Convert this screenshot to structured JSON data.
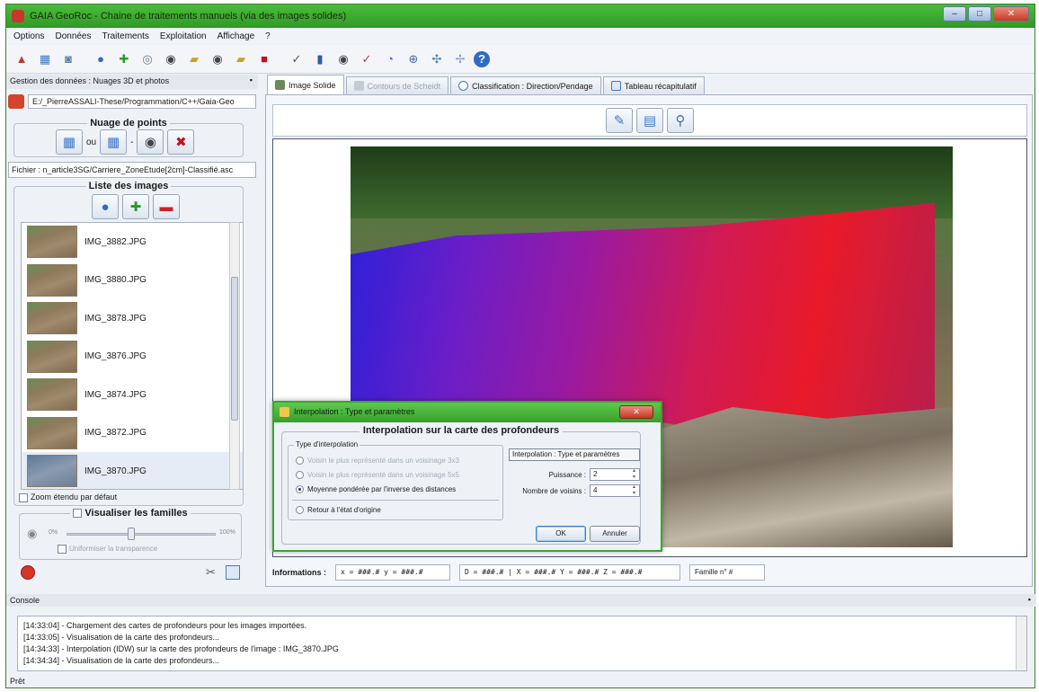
{
  "window": {
    "title": "GAIA GeoRoc - Chaine de traitements manuels (via des images solides)",
    "controls": {
      "minimize": "–",
      "maximize": "□",
      "close": "✕"
    }
  },
  "menu": [
    "Options",
    "Données",
    "Traitements",
    "Exploitation",
    "Affichage",
    "?"
  ],
  "toolbar_icons": [
    "open-project-icon",
    "gallery-icon",
    "camera-icon",
    "add-user-icon",
    "add-icon",
    "target-icon",
    "eye-icon",
    "folder-icon",
    "eye2-icon",
    "folder2-icon",
    "stop-icon",
    "check-icon",
    "book-icon",
    "eye3-icon",
    "check2-icon",
    "compass-icon",
    "zoom-icon",
    "pin-icon",
    "pin2-icon",
    "help-icon"
  ],
  "left_dock": {
    "title": "Gestion des données : Nuages 3D et photos",
    "path": "E:/_PierreASSALI-These/Programmation/C++/Gaia-Geo",
    "cloud_group_title": "Nuage de points",
    "ou_label": "ou",
    "file_label": "Fichier : n_article3SG/Carriere_ZoneEtude[2cm]-Classifié.asc",
    "images_group_title": "Liste des images",
    "images": [
      "IMG_3882.JPG",
      "IMG_3880.JPG",
      "IMG_3878.JPG",
      "IMG_3876.JPG",
      "IMG_3874.JPG",
      "IMG_3872.JPG",
      "IMG_3870.JPG"
    ],
    "selected_image_index": 6,
    "zoom_checkbox": "Zoom étendu par défaut",
    "families_title": "Visualiser les familles",
    "slider_min": "0%",
    "slider_max": "100%",
    "uniform_checkbox": "Uniformiser la transparence"
  },
  "tabs": [
    {
      "label": "Image Solide",
      "active": true
    },
    {
      "label": "Contours de Scheidt",
      "active": false
    },
    {
      "label": "Classification : Direction/Pendage",
      "active": false
    },
    {
      "label": "Tableau récapitulatif",
      "active": false
    }
  ],
  "info_bar": {
    "label": "Informations :",
    "xy": "x = ###.# y = ###.#",
    "coords": "D = ###.# | X = ###.# Y = ###.# Z = ###.#",
    "family": "Famille n° #"
  },
  "dialog": {
    "title": "Interpolation : Type et paramètres",
    "group_title": "Interpolation sur la carte des profondeurs",
    "type_title": "Type d'interpolation",
    "options": [
      {
        "label": "Voisin le plus représenté dans un voisinage 3x3",
        "enabled": false,
        "checked": false
      },
      {
        "label": "Voisin le plus représenté dans un voisinage 5x5",
        "enabled": false,
        "checked": false
      },
      {
        "label": "Moyenne pondérée par l'inverse des distances",
        "enabled": true,
        "checked": true
      }
    ],
    "reset_label": "Retour à l'état d'origine",
    "param_tag": "Interpolation : Type et paramètres",
    "power_label": "Puissance :",
    "power_value": "2",
    "neighbors_label": "Nombre de voisins :",
    "neighbors_value": "4",
    "ok_label": "OK",
    "cancel_label": "Annuler"
  },
  "console": {
    "title": "Console",
    "lines": [
      "[14:33:04] - Chargement des cartes de profondeurs pour les images importées.",
      "[14:33:05] - Visualisation de la carte des profondeurs...",
      "[14:34:33] - Interpolation (IDW) sur la carte des profondeurs de l'image : IMG_3870.JPG",
      "[14:34:34] - Visualisation de la carte des profondeurs..."
    ]
  },
  "status": "Prêt"
}
